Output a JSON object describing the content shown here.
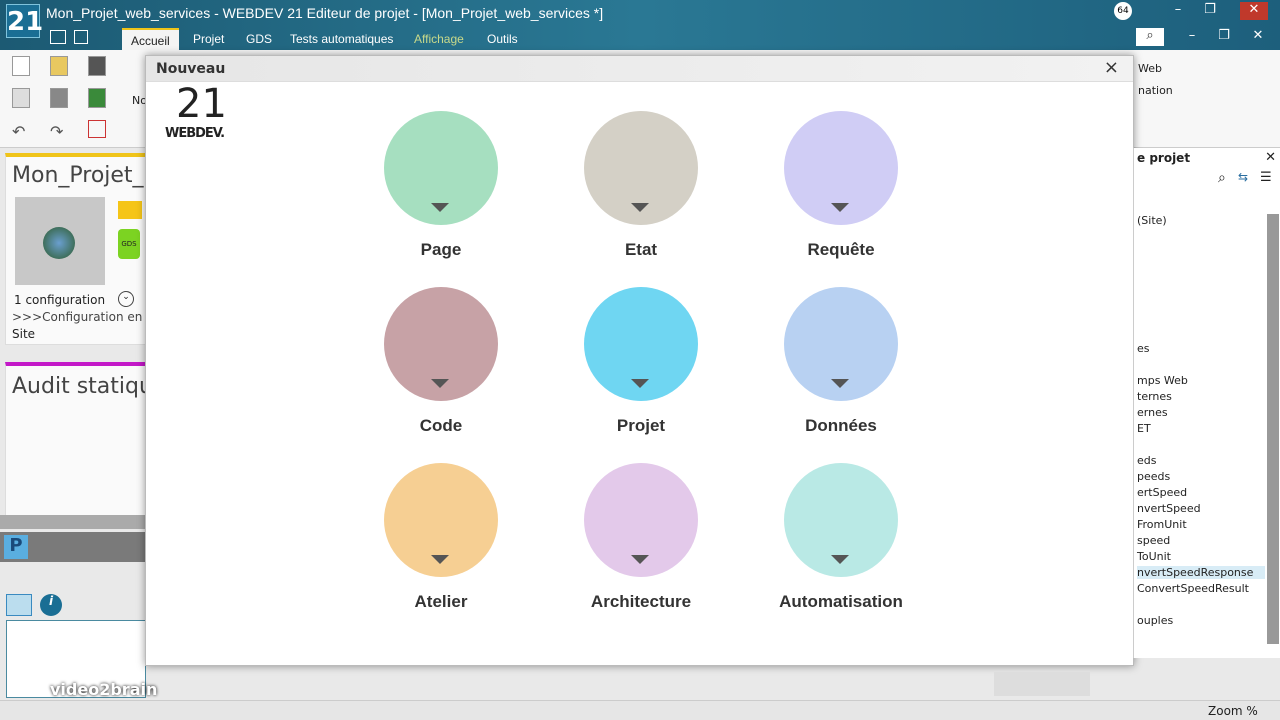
{
  "window": {
    "title": "Mon_Projet_web_services - WEBDEV 21  Editeur de projet - [Mon_Projet_web_services *]",
    "logo": "21",
    "badge": "64"
  },
  "ribbon_tabs": [
    {
      "label": "Accueil",
      "active": true
    },
    {
      "label": "Projet"
    },
    {
      "label": "GDS"
    },
    {
      "label": "Tests automatiques"
    },
    {
      "label": "Affichage"
    },
    {
      "label": "Outils"
    }
  ],
  "ribbon": {
    "truncated_label": "No",
    "right_items": [
      "Web",
      "nation"
    ]
  },
  "left": {
    "project_title": "Mon_Projet_",
    "config_count": "1 configuration",
    "config_line": ">>>Configuration en c",
    "config_type": "Site",
    "audit_title": "Audit statiqu",
    "gds_label": "GDS"
  },
  "dialog": {
    "title": "Nouveau",
    "close": "×",
    "brand_number": "21",
    "brand_name": "WEBDEV.",
    "items": [
      {
        "label": "Page",
        "color": "#a6dfc0",
        "icon": "web-page-icon"
      },
      {
        "label": "Etat",
        "color": "#d4d0c6",
        "icon": "report-icon"
      },
      {
        "label": "Requête",
        "color": "#d0cdf5",
        "icon": "query-icon"
      },
      {
        "label": "Code",
        "color": "#c7a2a6",
        "icon": "code-icon"
      },
      {
        "label": "Projet",
        "color": "#6fd6f2",
        "icon": "project-icon"
      },
      {
        "label": "Données",
        "color": "#b8d1f2",
        "icon": "database-icon"
      },
      {
        "label": "Atelier",
        "color": "#f6cf93",
        "icon": "tools-icon"
      },
      {
        "label": "Architecture",
        "color": "#e3c9ea",
        "icon": "architecture-icon"
      },
      {
        "label": "Automatisation",
        "color": "#b9e9e5",
        "icon": "automation-icon"
      }
    ]
  },
  "explorer": {
    "title": "e projet",
    "items": [
      "(Site)",
      "es",
      "mps Web",
      "ternes",
      "ernes",
      "ET",
      "eds",
      "peeds",
      "ertSpeed",
      "nvertSpeed",
      "FromUnit",
      "speed",
      "ToUnit",
      "nvertSpeedResponse",
      "ConvertSpeedResult",
      "ouples"
    ],
    "selected": "nvertSpeedResponse"
  },
  "status": {
    "zoom": "Zoom %"
  },
  "watermark": "video2brain"
}
